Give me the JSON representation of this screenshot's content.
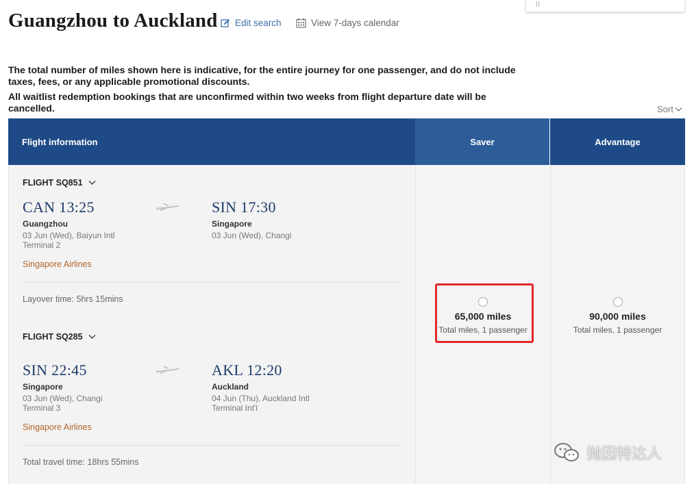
{
  "header": {
    "title": "Guangzhou to Auckland",
    "edit_search": "Edit search",
    "view_calendar": "View 7-days calendar"
  },
  "notices": {
    "miles": "The total number of miles shown here is indicative, for the entire journey for one passenger, and do not include taxes, fees, or any applicable promotional discounts.",
    "waitlist": "All waitlist redemption bookings that are unconfirmed within two weeks from flight departure date will be cancelled."
  },
  "sort_label": "Sort",
  "table": {
    "col_info": "Flight information",
    "col_saver": "Saver",
    "col_advantage": "Advantage"
  },
  "flights": [
    {
      "flight_no": "FLIGHT SQ851",
      "dep": {
        "code_time": "CAN 13:25",
        "city": "Guangzhou",
        "date_airport": "03 Jun (Wed), Baiyun Intl",
        "terminal": "Terminal 2"
      },
      "arr": {
        "code_time": "SIN 17:30",
        "city": "Singapore",
        "date_airport": "03 Jun (Wed), Changi",
        "terminal": ""
      },
      "airline": "Singapore Airlines"
    },
    {
      "flight_no": "FLIGHT SQ285",
      "dep": {
        "code_time": "SIN 22:45",
        "city": "Singapore",
        "date_airport": "03 Jun (Wed), Changi",
        "terminal": "Terminal 3"
      },
      "arr": {
        "code_time": "AKL 12:20",
        "city": "Auckland",
        "date_airport": "04 Jun (Thu), Auckland Intl",
        "terminal": "Terminal Int'l"
      },
      "airline": "Singapore Airlines"
    }
  ],
  "layover": "Layover time: 5hrs 15mins",
  "total_travel": "Total travel time: 18hrs 55mins",
  "fares": {
    "saver": {
      "miles": "65,000 miles",
      "sub": "Total miles, 1 passenger"
    },
    "advantage": {
      "miles": "90,000 miles",
      "sub": "Total miles, 1 passenger"
    }
  },
  "watermark": "抛因特达人",
  "colors": {
    "header_blue": "#1e4b87",
    "saver_blue": "#2d5d98",
    "airline_orange": "#b0642a",
    "highlight_red": "#e22727",
    "link_blue": "#3d6fa8"
  },
  "icons": [
    "edit-icon",
    "calendar-icon",
    "chevron-down-icon",
    "plane-icon",
    "wechat-icon"
  ]
}
